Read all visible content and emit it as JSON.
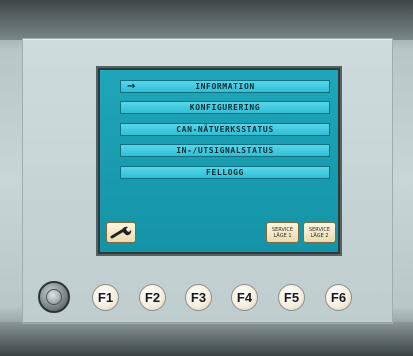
{
  "menu": {
    "items": [
      {
        "label": "INFORMATION",
        "selected": true
      },
      {
        "label": "KONFIGURERING",
        "selected": false
      },
      {
        "label": "CAN-NÄTVERKSSTATUS",
        "selected": false
      },
      {
        "label": "IN-/UTSIGNALSTATUS",
        "selected": false
      },
      {
        "label": "FELLOGG",
        "selected": false
      }
    ],
    "selection_marker": "→"
  },
  "softkeys": {
    "wrench_icon": "wrench-icon",
    "service1": {
      "line1": "SERVICE",
      "line2": "LÄGE 1"
    },
    "service2": {
      "line1": "SERVICE",
      "line2": "LÄGE 2"
    }
  },
  "function_keys": [
    "F1",
    "F2",
    "F3",
    "F4",
    "F5",
    "F6"
  ],
  "knob_icon": "rotary-knob",
  "colors": {
    "screen": "#1593a7",
    "menu_item": "#30bfd6",
    "softkey": "#eadbb1",
    "bezel": "#c8d6d8"
  }
}
